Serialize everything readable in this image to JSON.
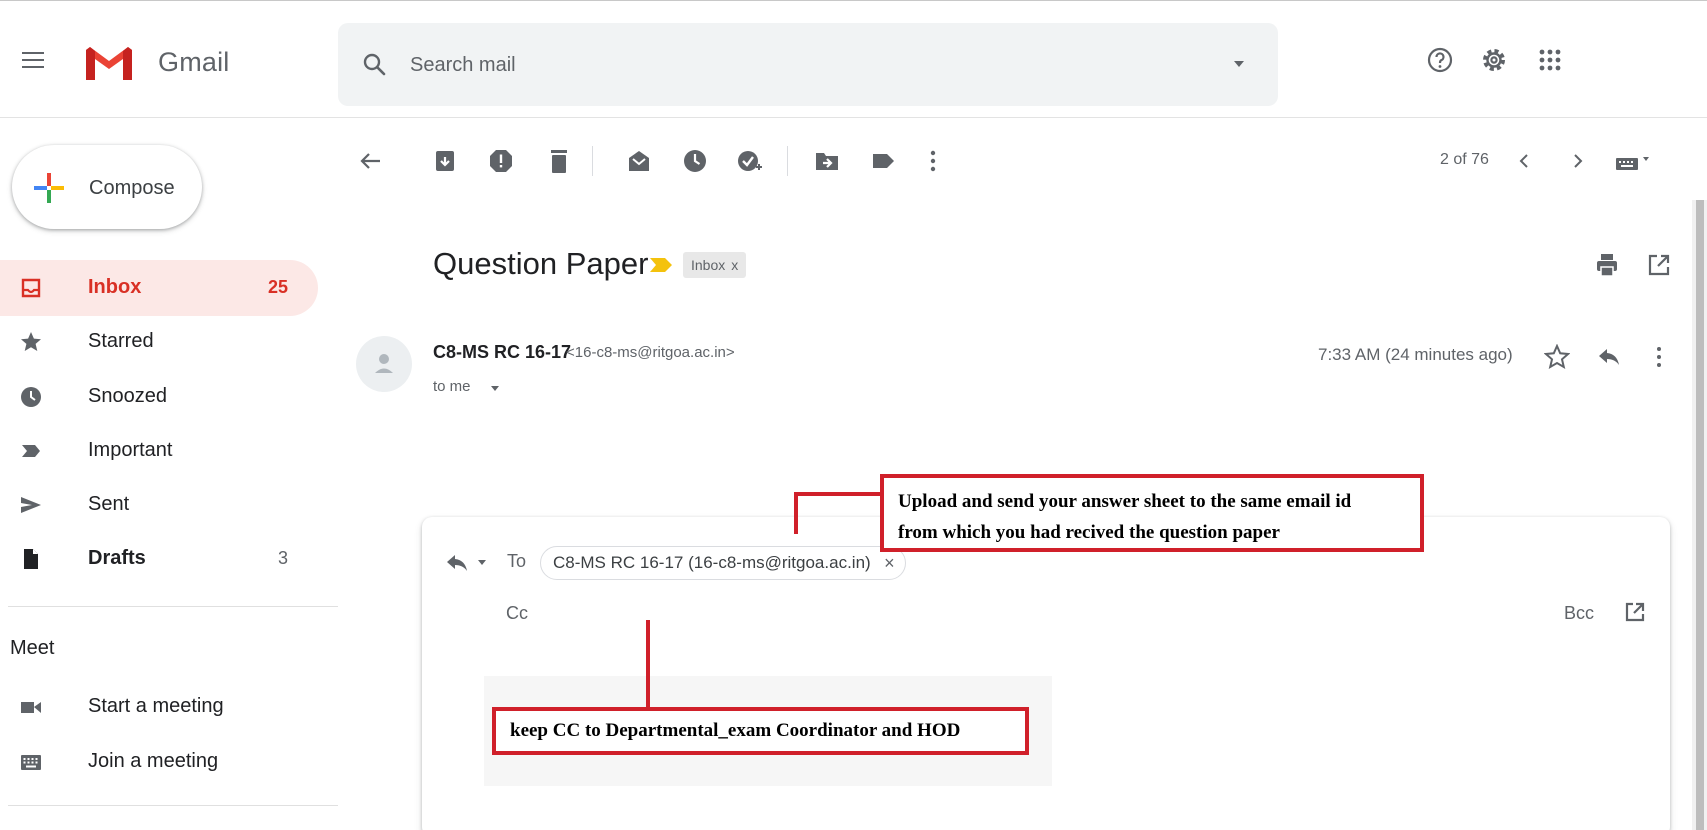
{
  "app": {
    "title": "Gmail",
    "menu_icon": "hamburger-menu-icon"
  },
  "search": {
    "placeholder": "Search mail",
    "icon": "search-icon"
  },
  "header_icons": [
    "help-icon",
    "settings-icon",
    "apps-grid-icon"
  ],
  "sidebar": {
    "compose_label": "Compose",
    "items": [
      {
        "label": "Inbox",
        "count": "25",
        "icon": "inbox-icon",
        "active": true
      },
      {
        "label": "Starred",
        "count": "",
        "icon": "star-icon"
      },
      {
        "label": "Snoozed",
        "count": "",
        "icon": "clock-icon"
      },
      {
        "label": "Important",
        "count": "",
        "icon": "important-icon"
      },
      {
        "label": "Sent",
        "count": "",
        "icon": "send-icon"
      },
      {
        "label": "Drafts",
        "count": "3",
        "icon": "draft-icon"
      }
    ],
    "meet": {
      "heading": "Meet",
      "items": [
        {
          "label": "Start a meeting",
          "icon": "video-icon"
        },
        {
          "label": "Join a meeting",
          "icon": "keyboard-icon"
        }
      ]
    }
  },
  "toolbar": {
    "pager": "2 of 76"
  },
  "message": {
    "subject": "Question Paper",
    "label_chip": "Inbox",
    "label_chip_close": "x",
    "sender_name": "C8-MS RC 16-17",
    "sender_email": "<16-c8-ms@ritgoa.ac.in>",
    "to_me": "to me",
    "timestamp": "7:33 AM (24 minutes ago)"
  },
  "reply": {
    "to_label": "To",
    "recipient": "C8-MS RC 16-17 (16-c8-ms@ritgoa.ac.in)",
    "recipient_close": "×",
    "cc_label": "Cc",
    "bcc_label": "Bcc"
  },
  "annotations": {
    "upload_line1": "Upload and send your answer sheet to the same email id",
    "upload_line2": "from which you had recived the question paper",
    "cc_note": "keep CC to Departmental_exam Coordinator and HOD",
    "color": "#d0202a"
  },
  "colors": {
    "accent_red": "#d93025",
    "inbox_active_bg": "#fce8e6",
    "important_yellow": "#f4c20d"
  }
}
